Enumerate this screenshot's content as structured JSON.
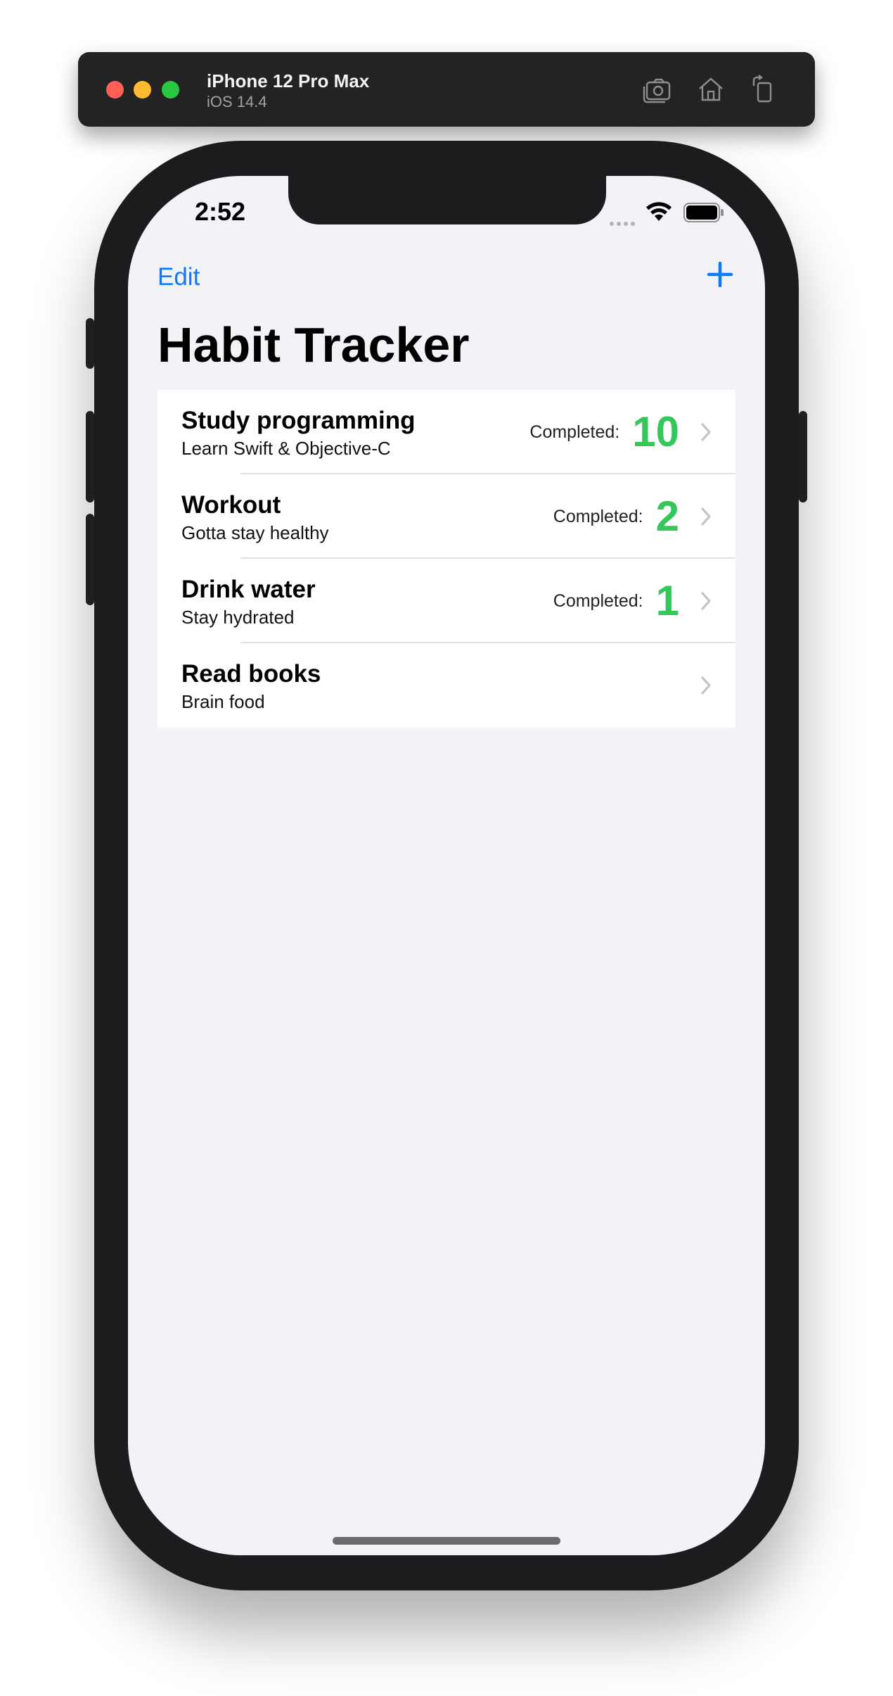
{
  "simulator": {
    "device_name": "iPhone 12 Pro Max",
    "os_version": "iOS 14.4",
    "toolbar_icons": [
      "screenshot-icon",
      "home-icon",
      "rotate-icon"
    ]
  },
  "status_bar": {
    "time": "2:52",
    "icons": [
      "signal-dots-icon",
      "wifi-icon",
      "battery-icon"
    ]
  },
  "nav": {
    "edit_label": "Edit",
    "add_icon": "plus-icon",
    "title": "Habit Tracker"
  },
  "habits": [
    {
      "title": "Study programming",
      "subtitle": "Learn Swift & Objective-C",
      "completed_label": "Completed:",
      "completed_count": "10"
    },
    {
      "title": "Workout",
      "subtitle": "Gotta stay healthy",
      "completed_label": "Completed:",
      "completed_count": "2"
    },
    {
      "title": "Drink water",
      "subtitle": "Stay hydrated",
      "completed_label": "Completed:",
      "completed_count": "1"
    },
    {
      "title": "Read books",
      "subtitle": "Brain food",
      "completed_label": "",
      "completed_count": ""
    }
  ],
  "colors": {
    "accent": "#0a7aff",
    "count_green": "#34c759",
    "background": "#f2f2f7"
  }
}
